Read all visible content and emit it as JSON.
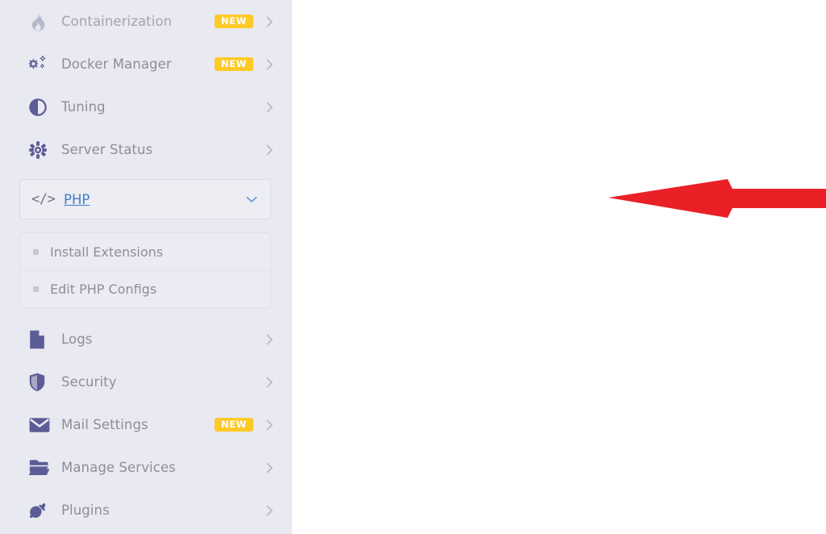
{
  "sidebar": {
    "items_top": [
      {
        "label": "Containerization",
        "icon": "fire-icon",
        "badge": "NEW",
        "chevron": "chevron-right-icon",
        "faded": true,
        "name": "containerization"
      },
      {
        "label": "Docker Manager",
        "icon": "cogs-icon",
        "badge": "NEW",
        "chevron": "chevron-right-icon",
        "faded": false,
        "name": "docker-manager"
      },
      {
        "label": "Tuning",
        "icon": "contrast-circle-icon",
        "badge": null,
        "chevron": "chevron-right-icon",
        "faded": false,
        "name": "tuning"
      },
      {
        "label": "Server Status",
        "icon": "gear-icon",
        "badge": null,
        "chevron": "chevron-right-icon",
        "faded": false,
        "name": "server-status"
      }
    ],
    "php_section": {
      "label": "PHP",
      "icon": "code-brackets-icon",
      "icon_glyph": "</>",
      "chevron": "chevron-down-icon",
      "expanded": true,
      "link_color": "#3f7fc1",
      "submenu": [
        {
          "label": "Install Extensions",
          "name": "install-extensions"
        },
        {
          "label": "Edit PHP Configs",
          "name": "edit-php-configs"
        }
      ]
    },
    "items_bottom": [
      {
        "label": "Logs",
        "icon": "file-document-icon",
        "badge": null,
        "chevron": "chevron-right-icon",
        "name": "logs"
      },
      {
        "label": "Security",
        "icon": "shield-icon",
        "badge": null,
        "chevron": "chevron-right-icon",
        "name": "security"
      },
      {
        "label": "Mail Settings",
        "icon": "envelope-icon",
        "badge": "NEW",
        "chevron": "chevron-right-icon",
        "name": "mail-settings"
      },
      {
        "label": "Manage Services",
        "icon": "folder-open-icon",
        "badge": null,
        "chevron": "chevron-right-icon",
        "name": "manage-services"
      },
      {
        "label": "Plugins",
        "icon": "power-plug-icon",
        "badge": null,
        "chevron": "chevron-right-icon",
        "name": "plugins"
      }
    ],
    "colors": {
      "background": "#e9e9f1",
      "icon": "#5c5c96",
      "label": "#8d8d9c",
      "badge_background": "#ffc926",
      "badge_text": "#ffffff",
      "active_link": "#3f7fc1"
    }
  },
  "content": {
    "background": "#ffffff",
    "annotation": {
      "type": "arrow",
      "direction": "left",
      "color": "#ea2027",
      "points_to": "PHP"
    }
  }
}
